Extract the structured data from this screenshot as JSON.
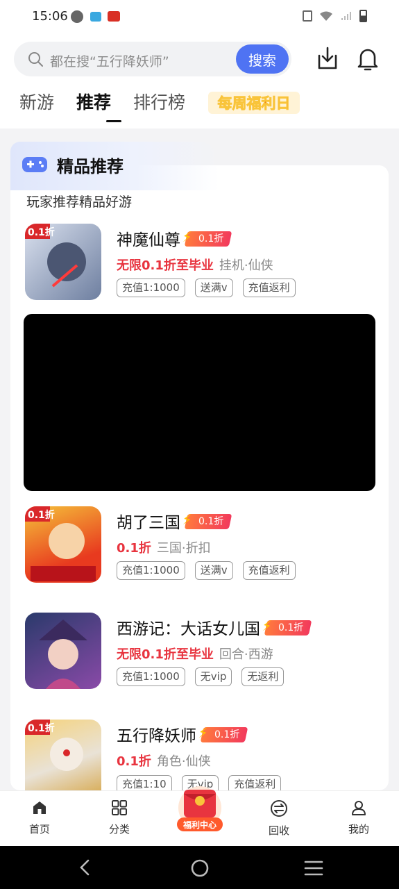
{
  "status_bar": {
    "time": "15:06"
  },
  "search": {
    "placeholder": "都在搜“五行降妖师”",
    "button": "搜索"
  },
  "tabs": [
    {
      "label": "新游"
    },
    {
      "label": "推荐",
      "active": true
    },
    {
      "label": "排行榜"
    },
    {
      "label": "每周福利日"
    }
  ],
  "section": {
    "title": "精品推荐",
    "subtitle": "玩家推荐精品好游"
  },
  "games": [
    {
      "name": "神魔仙尊",
      "badge": "0.1折",
      "highlight": "无限0.1折至毕业",
      "category": "挂机·仙侠",
      "tags": [
        "充值1:1000",
        "送满v",
        "充值返利"
      ],
      "icon_colors": [
        "#c9d3e6",
        "#6a7a99"
      ]
    },
    {
      "name": "胡了三国",
      "badge": "0.1折",
      "highlight": "0.1折",
      "category": "三国·折扣",
      "tags": [
        "充值1:1000",
        "送满v",
        "充值返利"
      ],
      "icon_colors": [
        "#e83a1f",
        "#f5c23a"
      ]
    },
    {
      "name": "西游记：大话女儿国",
      "badge": "0.1折",
      "highlight": "无限0.1折至毕业",
      "category": "回合·西游",
      "tags": [
        "充值1:1000",
        "无vip",
        "无返利"
      ],
      "icon_colors": [
        "#2a3a6b",
        "#a65ab8"
      ]
    },
    {
      "name": "五行降妖师",
      "badge": "0.1折",
      "highlight": "0.1折",
      "category": "角色·仙侠",
      "tags": [
        "充值1:10",
        "无vip",
        "充值返利"
      ],
      "icon_colors": [
        "#f0c05a",
        "#e8e1d5"
      ]
    }
  ],
  "bottom_nav": [
    {
      "label": "首页",
      "icon": "home-icon"
    },
    {
      "label": "分类",
      "icon": "grid-icon"
    },
    {
      "label": "福利中心",
      "icon": "gift-icon"
    },
    {
      "label": "回收",
      "icon": "exchange-icon"
    },
    {
      "label": "我的",
      "icon": "user-icon"
    }
  ],
  "colors": {
    "accent": "#4f73f3",
    "sale_red": "#e8343f"
  }
}
